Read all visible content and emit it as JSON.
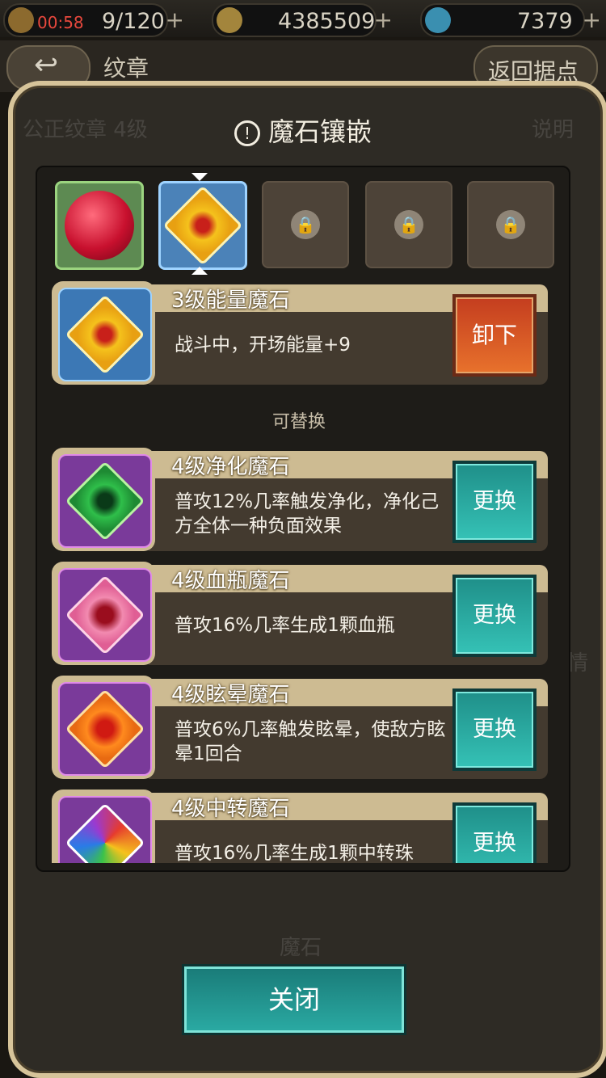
{
  "topbar": {
    "timer": "00:58",
    "stamina": "9/120",
    "gold": "4385509",
    "gems": "7379",
    "plus": "+"
  },
  "subbar": {
    "back_icon": "↩",
    "title": "纹章",
    "return_label": "返回据点"
  },
  "background": {
    "emblem": "公正纹章 4级",
    "help": "说明",
    "details": "详情",
    "stones": "魔石"
  },
  "modal": {
    "warn_icon": "!",
    "title": "魔石镶嵌",
    "slots": [
      {
        "kind": "red-gem",
        "state": "equipped"
      },
      {
        "kind": "energy-gem",
        "state": "selected"
      },
      {
        "kind": "lock",
        "shape": "triangle"
      },
      {
        "kind": "lock",
        "shape": "circle"
      },
      {
        "kind": "lock",
        "shape": "diamond"
      }
    ],
    "equipped": {
      "name": "3级能量魔石",
      "desc": "战斗中，开场能量+9",
      "button": "卸下"
    },
    "replaceable_label": "可替换",
    "candidates": [
      {
        "name": "4级净化魔石",
        "desc": "普攻12%几率触发净化，净化己方全体一种负面效果",
        "button": "更换"
      },
      {
        "name": "4级血瓶魔石",
        "desc": "普攻16%几率生成1颗血瓶",
        "button": "更换"
      },
      {
        "name": "4级眩晕魔石",
        "desc": "普攻6%几率触发眩晕，使敌方眩晕1回合",
        "button": "更换"
      },
      {
        "name": "4级中转魔石",
        "desc": "普攻16%几率生成1颗中转珠",
        "button": "更换"
      }
    ],
    "close_label": "关闭"
  },
  "colors": {
    "gold_border": "#d7c49a",
    "unload_button": "#e8722c",
    "swap_button": "#2aa9a2"
  }
}
